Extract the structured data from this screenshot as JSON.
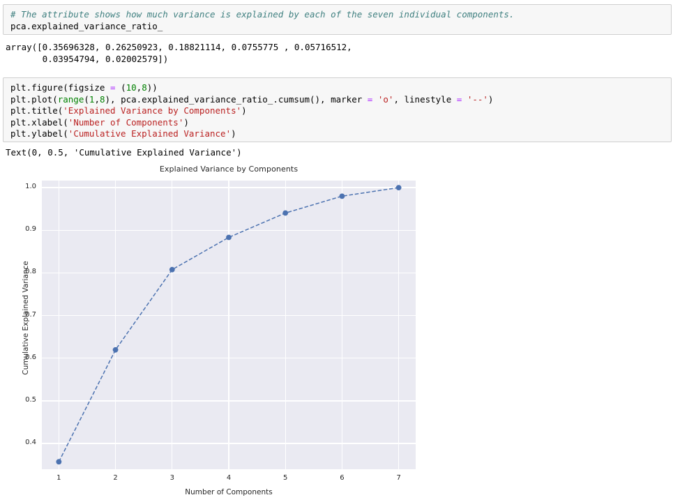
{
  "cells": [
    {
      "id": "cell-1",
      "lines": [
        [
          {
            "t": "# The attribute shows how much variance is explained by each of the seven individual components.",
            "c": "comment"
          }
        ],
        [
          {
            "t": "pca.explained_variance_ratio_",
            "c": "plain"
          }
        ]
      ]
    },
    {
      "id": "cell-2",
      "lines": [
        [
          {
            "t": "plt.figure(figsize ",
            "c": "plain"
          },
          {
            "t": "=",
            "c": "op"
          },
          {
            "t": " ",
            "c": "plain"
          },
          {
            "t": "(",
            "c": "plain"
          },
          {
            "t": "10",
            "c": "number"
          },
          {
            "t": ",",
            "c": "plain"
          },
          {
            "t": "8",
            "c": "number"
          },
          {
            "t": "))",
            "c": "plain"
          }
        ],
        [
          {
            "t": "plt.plot(",
            "c": "plain"
          },
          {
            "t": "range",
            "c": "func"
          },
          {
            "t": "(",
            "c": "plain"
          },
          {
            "t": "1",
            "c": "number"
          },
          {
            "t": ",",
            "c": "plain"
          },
          {
            "t": "8",
            "c": "number"
          },
          {
            "t": "), pca.explained_variance_ratio_.cumsum(), marker ",
            "c": "plain"
          },
          {
            "t": "=",
            "c": "op"
          },
          {
            "t": " ",
            "c": "plain"
          },
          {
            "t": "'o'",
            "c": "string"
          },
          {
            "t": ", linestyle ",
            "c": "plain"
          },
          {
            "t": "=",
            "c": "op"
          },
          {
            "t": " ",
            "c": "plain"
          },
          {
            "t": "'--'",
            "c": "string"
          },
          {
            "t": ")",
            "c": "plain"
          }
        ],
        [
          {
            "t": "plt.title(",
            "c": "plain"
          },
          {
            "t": "'Explained Variance by Components'",
            "c": "string"
          },
          {
            "t": ")",
            "c": "plain"
          }
        ],
        [
          {
            "t": "plt.xlabel(",
            "c": "plain"
          },
          {
            "t": "'Number of Components'",
            "c": "string"
          },
          {
            "t": ")",
            "c": "plain"
          }
        ],
        [
          {
            "t": "plt.ylabel(",
            "c": "plain"
          },
          {
            "t": "'Cumulative Explained Variance'",
            "c": "string"
          },
          {
            "t": ")",
            "c": "plain"
          }
        ]
      ]
    }
  ],
  "outputs": {
    "array_output_line1": "array([0.35696328, 0.26250923, 0.18821114, 0.0755775 , 0.05716512,",
    "array_output_line2": "       0.03954794, 0.02002579])",
    "text_output": "Text(0, 0.5, 'Cumulative Explained Variance')"
  },
  "chart_data": {
    "type": "line",
    "title": "Explained Variance by Components",
    "xlabel": "Number of Components",
    "ylabel": "Cumulative Explained Variance",
    "x": [
      1,
      2,
      3,
      4,
      5,
      6,
      7
    ],
    "y": [
      0.35696328,
      0.61947251,
      0.80768365,
      0.88326115,
      0.94042627,
      0.97997421,
      1.0
    ],
    "xticks": [
      1,
      2,
      3,
      4,
      5,
      6,
      7
    ],
    "xtick_labels": [
      "1",
      "2",
      "3",
      "4",
      "5",
      "6",
      "7"
    ],
    "yticks": [
      0.4,
      0.5,
      0.6,
      0.7,
      0.8,
      0.9,
      1.0
    ],
    "ytick_labels": [
      "0.4",
      "0.5",
      "0.6",
      "0.7",
      "0.8",
      "0.9",
      "1.0"
    ],
    "xlim": [
      0.7,
      7.3
    ],
    "ylim": [
      0.3395,
      1.0165
    ],
    "grid": true,
    "legend": null,
    "marker": "o",
    "linestyle": "--",
    "line_color": "#4c72b0",
    "marker_color": "#4c72b0",
    "plot_bg": "#eaeaf2",
    "grid_color": "#ffffff"
  }
}
